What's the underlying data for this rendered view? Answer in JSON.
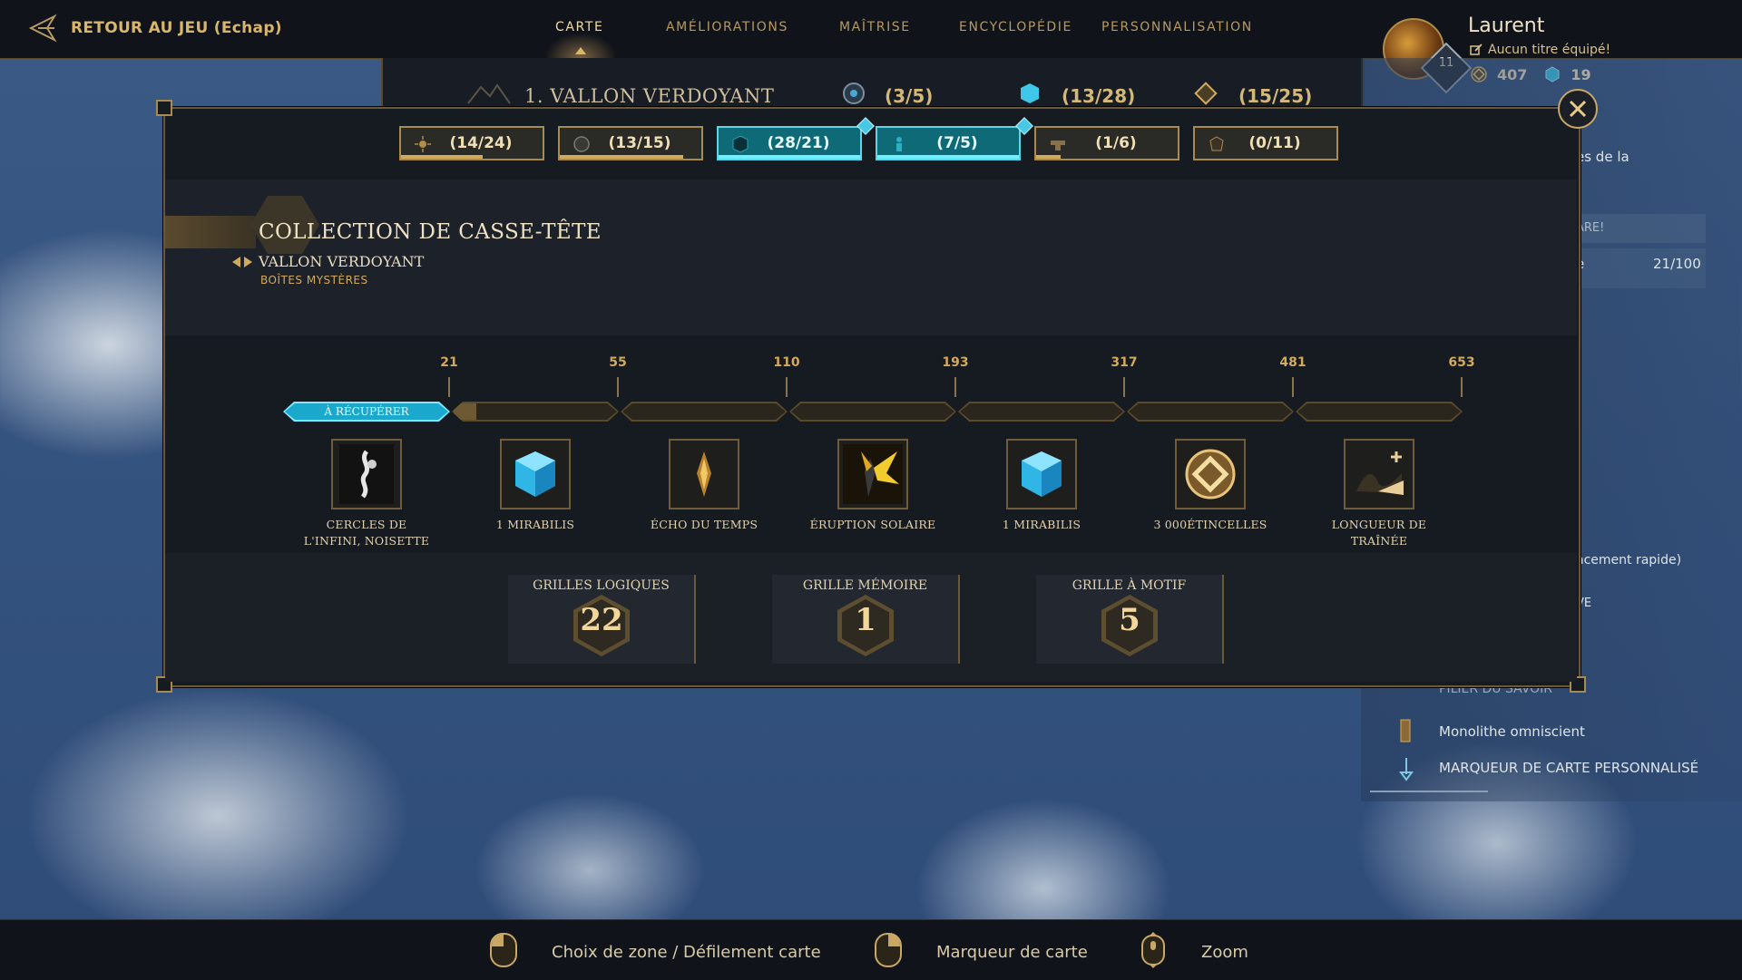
{
  "topbar": {
    "back_label": "RETOUR AU JEU (Echap)",
    "tabs": [
      "CARTE",
      "AMÉLIORATIONS",
      "MAÎTRISE",
      "ENCYCLOPÉDIE",
      "PERSONNALISATION"
    ],
    "active_tab": "CARTE"
  },
  "player": {
    "name": "Laurent",
    "title": "Aucun titre équipé!",
    "level": "11",
    "sparks": "407",
    "mirabilis": "19"
  },
  "zone_strip": {
    "name": "1. VALLON VERDOYANT",
    "counts": [
      "(3/5)",
      "(13/28)",
      "(15/25)"
    ]
  },
  "side_panel": {
    "items": [
      "es de la",
      "ARE!",
      "e",
      "21/100",
      "acement rapide)",
      "VE",
      "PILIER DU SAVOIR",
      "Monolithe omniscient",
      "MARQUEUR DE CARTE PERSONNALISÉ"
    ]
  },
  "category_tabs": [
    {
      "label": "(14/24)",
      "progress": 0.58,
      "icon": "sun-icon",
      "active": false
    },
    {
      "label": "(13/15)",
      "progress": 0.87,
      "icon": "orb-icon",
      "active": false
    },
    {
      "label": "(28/21)",
      "progress": 1.0,
      "icon": "cube-icon",
      "active": true
    },
    {
      "label": "(7/5)",
      "progress": 1.0,
      "icon": "figure-icon",
      "active": true
    },
    {
      "label": "(1/6)",
      "progress": 0.17,
      "icon": "anvil-icon",
      "active": false
    },
    {
      "label": "(0/11)",
      "progress": 0.0,
      "icon": "crest-icon",
      "active": false
    }
  ],
  "collection": {
    "title": "COLLECTION DE CASSE-TÊTE",
    "region": "VALLON VERDOYANT",
    "subcategory": "BOÎTES MYSTÈRES"
  },
  "track": {
    "claim_label": "À RÉCUPÉRER",
    "thresholds": [
      "21",
      "55",
      "110",
      "193",
      "317",
      "481",
      "653"
    ],
    "segment_fill": [
      1.0,
      0.14,
      0,
      0,
      0,
      0,
      0
    ],
    "rewards": [
      {
        "label": "CERCLES DE L'INFINI, NOISETTE",
        "icon": "cosmetic-rings-icon"
      },
      {
        "label": "1 MIRABILIS",
        "icon": "mirabilis-cube-icon"
      },
      {
        "label": "ÉCHO DU TEMPS",
        "icon": "echo-icon"
      },
      {
        "label": "ÉRUPTION SOLAIRE",
        "icon": "solar-flare-icon"
      },
      {
        "label": "1 MIRABILIS",
        "icon": "mirabilis-cube-icon"
      },
      {
        "label": "3 000ÉTINCELLES",
        "icon": "spark-coin-icon"
      },
      {
        "label": "LONGUEUR DE TRAÎNÉE",
        "icon": "trail-length-icon"
      }
    ]
  },
  "stats": [
    {
      "label": "GRILLES LOGIQUES",
      "value": "22"
    },
    {
      "label": "GRILLE MÉMOIRE",
      "value": "1"
    },
    {
      "label": "GRILLE À MOTIF",
      "value": "5"
    }
  ],
  "bottombar": {
    "hints": [
      "Choix de zone / Défilement carte",
      "Marqueur de carte",
      "Zoom"
    ]
  },
  "colors": {
    "gold": "#d2aa5c",
    "cyan_active": "#0f6a78",
    "panel": "#161a21"
  }
}
